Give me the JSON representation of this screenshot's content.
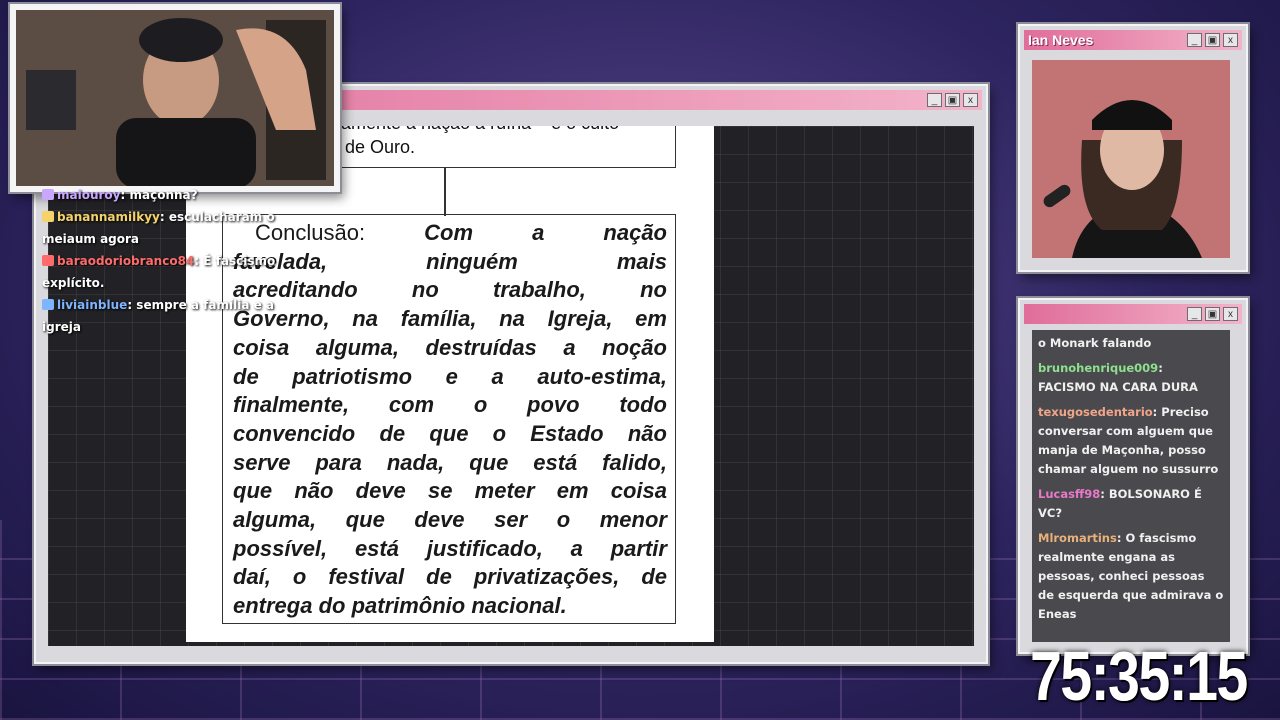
{
  "colors": {
    "titlebar_start": "#e06d9a",
    "titlebar_end": "#f3b3c9",
    "chat_bg": "#4a4a4e",
    "doc_bg": "#ffffff"
  },
  "main_window": {
    "controls": {
      "minimize": "_",
      "maximize": "▣",
      "close": "x"
    },
    "document": {
      "prev_box_line1": "amente a nação à ruína – e o culto",
      "prev_box_line2": "de Ouro.",
      "conclusion_lines": [
        [
          "Conclusão:",
          "Com",
          "a",
          "nação"
        ],
        [
          "favelada,",
          "ninguém",
          "mais"
        ],
        [
          "acreditando",
          "no",
          "trabalho,",
          "no"
        ],
        [
          "Governo,",
          "na",
          "família,",
          "na",
          "Igreja,",
          "em"
        ],
        [
          "coisa",
          "alguma,",
          "destruídas",
          "a",
          "noção"
        ],
        [
          "de",
          "patriotismo",
          "e",
          "a",
          "auto-estima,"
        ],
        [
          "finalmente,",
          "com",
          "o",
          "povo",
          "todo"
        ],
        [
          "convencido",
          "de",
          "que",
          "o",
          "Estado",
          "não"
        ],
        [
          "serve",
          "para",
          "nada,",
          "que",
          "está",
          "falido,"
        ],
        [
          "que",
          "não",
          "deve",
          "se",
          "meter",
          "em",
          "coisa"
        ],
        [
          "alguma,",
          "que",
          "deve",
          "ser",
          "o",
          "menor"
        ],
        [
          "possível,",
          "está",
          "justificado,",
          "a",
          "partir"
        ],
        [
          "daí,",
          "o",
          "festival",
          "de",
          "privatizações,",
          "de"
        ],
        [
          "entrega do patrimônio nacional."
        ]
      ]
    }
  },
  "cam2": {
    "title": "Ian Neves"
  },
  "overlay_chat": [
    {
      "user": "malouroy",
      "text": "maçonna?",
      "user_color": "#c9a7ff"
    },
    {
      "user": "banannamilkyy",
      "text": "esculacharam o meiaum agora",
      "user_color": "#f5d26a"
    },
    {
      "user": "baraodoriobranco84",
      "text": "É fascismo explícito.",
      "user_color": "#ff6b6b"
    },
    {
      "user": "liviainblue",
      "text": "sempre a família e a igreja",
      "user_color": "#7fb4ff"
    }
  ],
  "side_chat": [
    {
      "user": "",
      "text": "o Monark falando",
      "user_color": "#ffffff"
    },
    {
      "user": "brunohenrique009",
      "text": "FACISMO NA CARA DURA",
      "user_color": "#8ee08e"
    },
    {
      "user": "texugosedentario",
      "text": "Preciso conversar com alguem que manja de Maçonha, posso chamar alguem no sussurro",
      "user_color": "#f0a58a"
    },
    {
      "user": "Lucasff98",
      "text": "BOLSONARO É VC?",
      "user_color": "#e879c8"
    },
    {
      "user": "Mlromartins",
      "text": "O fascismo realmente engana as pessoas, conheci pessoas de esquerda que admirava o Eneas",
      "user_color": "#e8b07a"
    }
  ],
  "timer": "75:35:15"
}
